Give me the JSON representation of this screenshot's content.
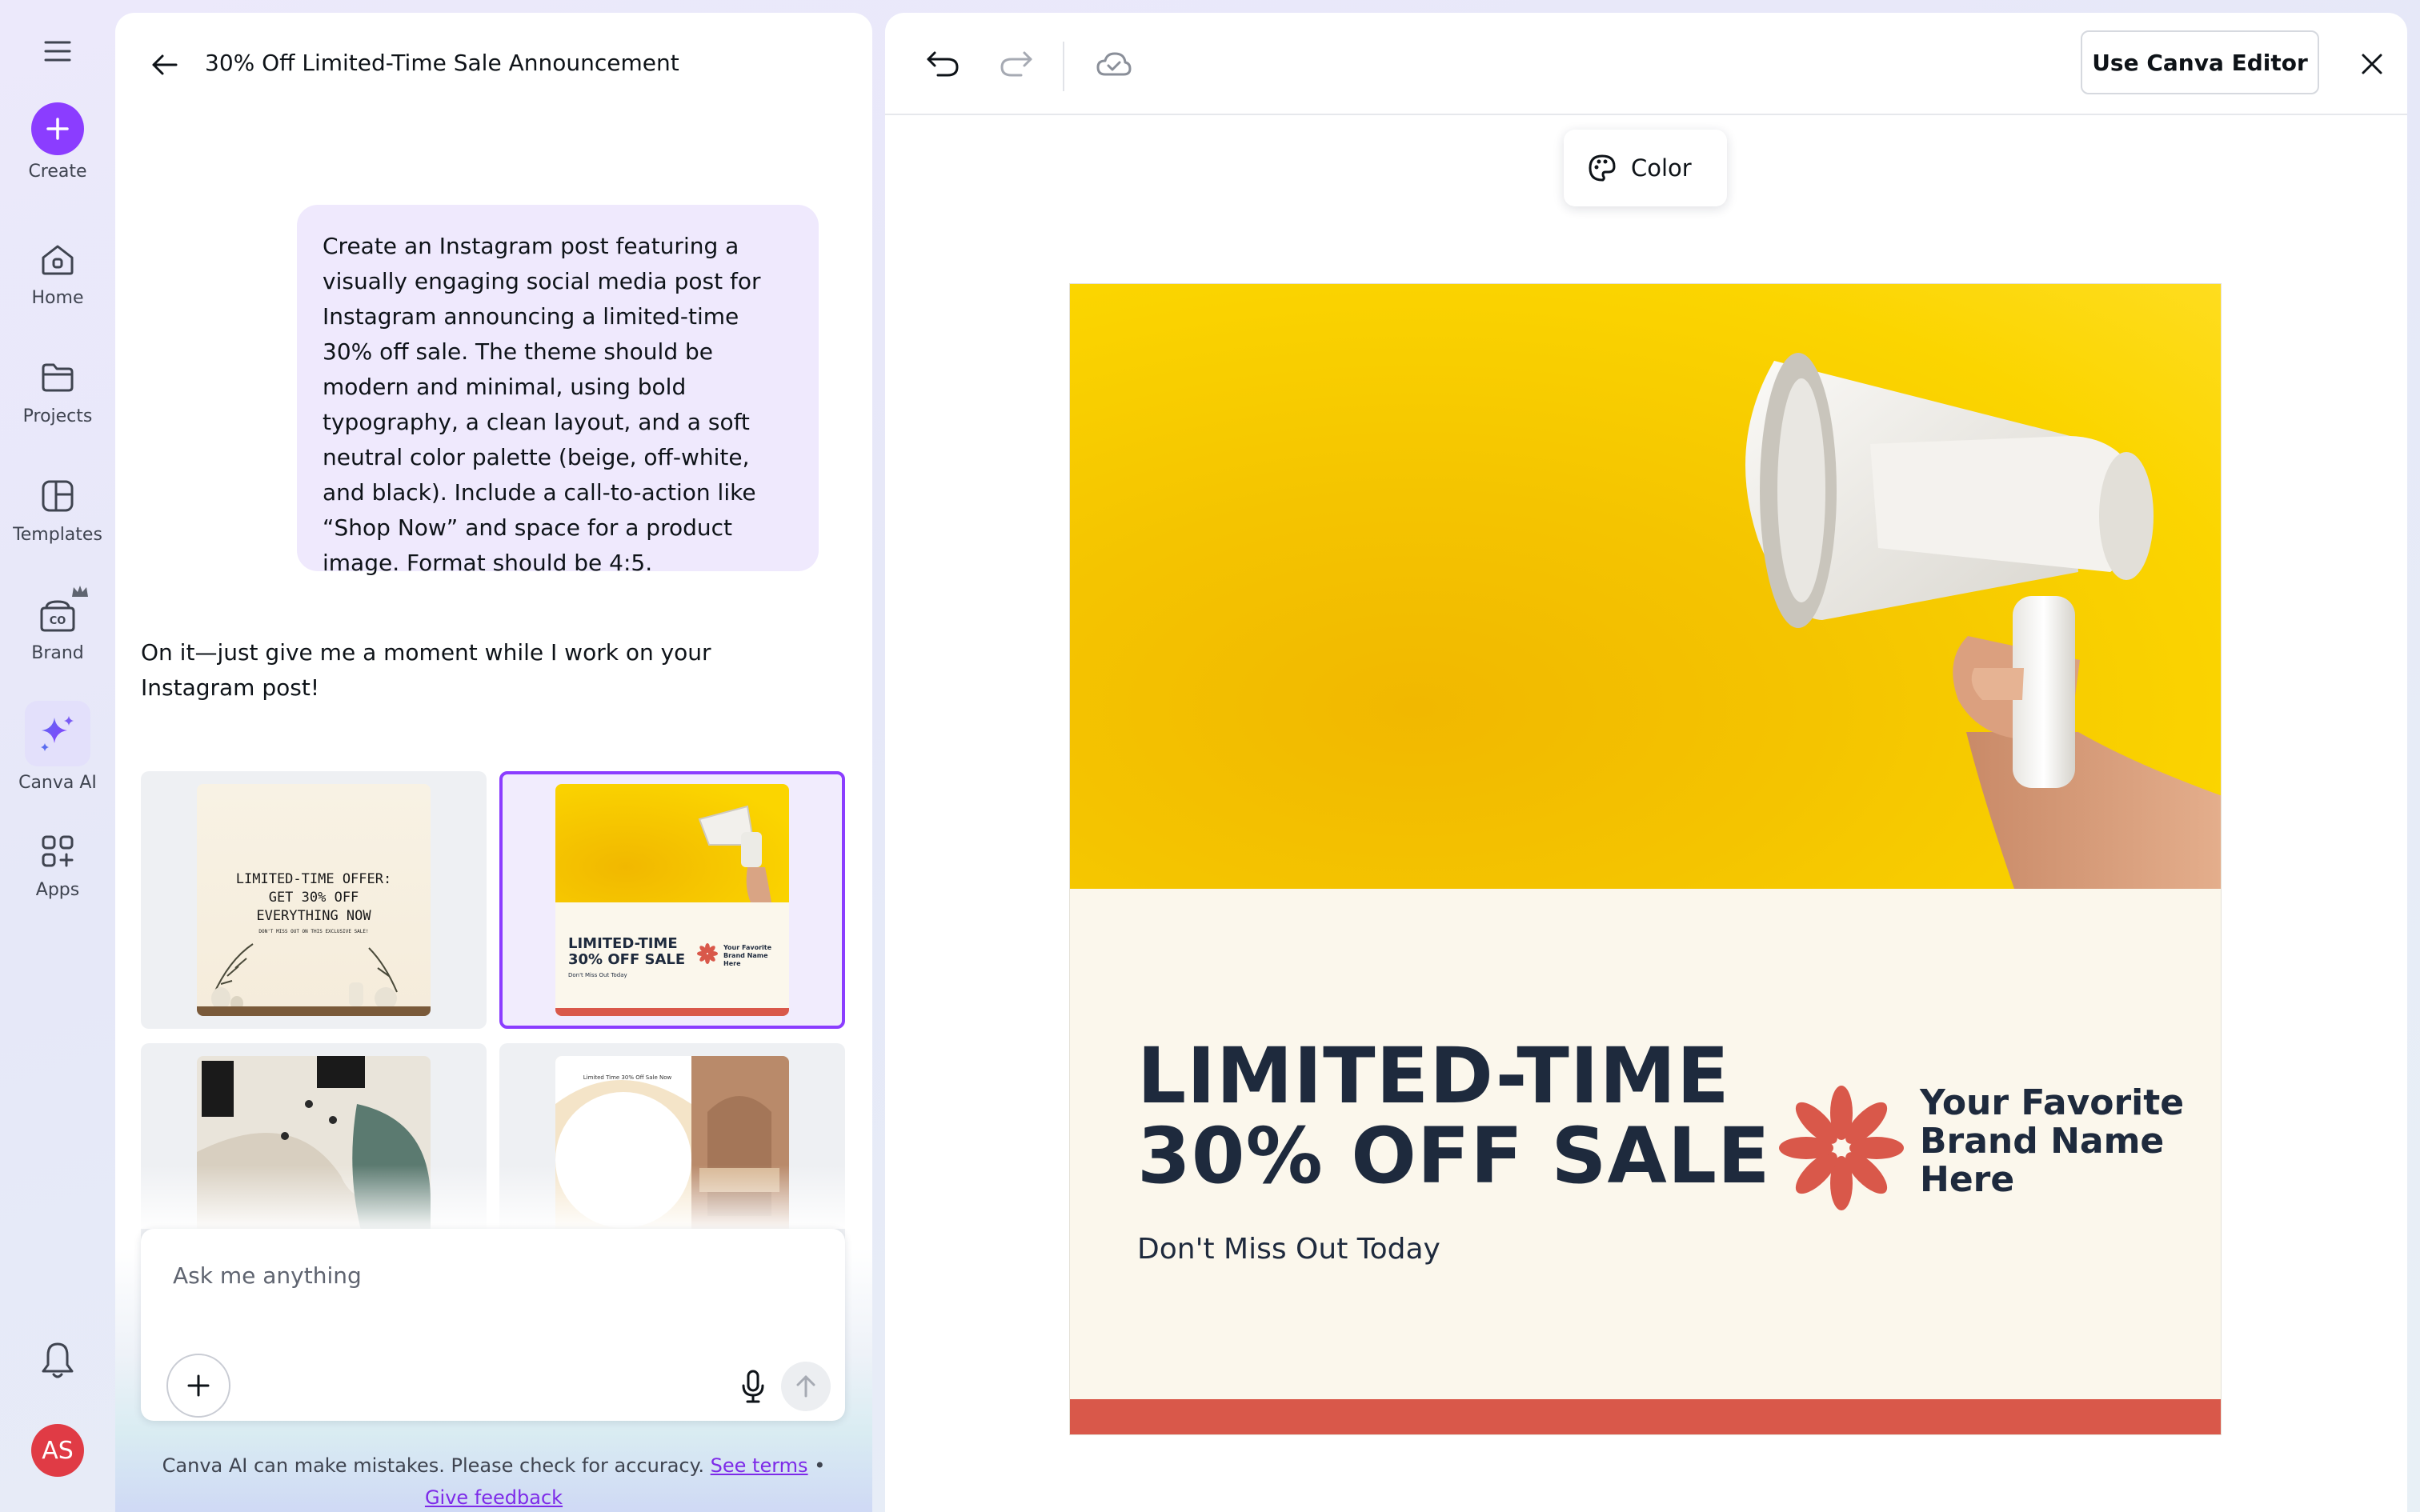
{
  "nav": {
    "create_label": "Create",
    "home_label": "Home",
    "projects_label": "Projects",
    "templates_label": "Templates",
    "brand_label": "Brand",
    "canva_ai_label": "Canva AI",
    "apps_label": "Apps",
    "avatar_initials": "AS"
  },
  "chat": {
    "title": "30% Off Limited-Time Sale Announcement",
    "user_prompt": "Create an Instagram post featuring a visually engaging social media post for Instagram announcing a limited-time 30% off sale. The theme should be modern and minimal, using bold typography, a clean layout, and a soft neutral color palette (beige, off-white, and black). Include a call-to-action like “Shop Now” and space for a product image. Format should be 4:5.",
    "ai_reply": "On it—just give me a moment while I work on your Instagram post!",
    "thumbnails": {
      "t1_line1": "LIMITED-TIME OFFER:",
      "t1_line2": "GET 30% OFF",
      "t1_line3": "EVERYTHING NOW",
      "t1_small": "DON'T MISS OUT ON THIS EXCLUSIVE SALE!",
      "t2_line1": "LIMITED-TIME",
      "t2_line2": "30% OFF SALE",
      "t2_small": "Don't Miss Out Today",
      "t2_brand": "Your Favorite Brand Name Here",
      "t4_small": "Limited Time 30% Off Sale Now"
    },
    "input_placeholder": "Ask me anything",
    "disclaimer_text": "Canva AI can make mistakes. Please check for accuracy.",
    "see_terms": "See terms",
    "separator": "•",
    "give_feedback": "Give feedback"
  },
  "editor": {
    "use_editor_label": "Use Canva Editor",
    "color_label": "Color",
    "design": {
      "headline_line1": "LIMITED-TIME",
      "headline_line2": "30% OFF SALE",
      "subtext": "Don't Miss Out Today",
      "brand_line1": "Your Favorite",
      "brand_line2": "Brand Name",
      "brand_line3": "Here"
    }
  },
  "colors": {
    "accent_purple": "#8b3dff",
    "design_yellow": "#f6c800",
    "design_cream": "#fbf7ec",
    "design_red": "#d9584a",
    "design_navy": "#1e2a3d"
  },
  "icons": [
    "menu-icon",
    "plus-icon",
    "home-icon",
    "folder-icon",
    "templates-icon",
    "brand-icon",
    "crown-icon",
    "sparkle-icon",
    "apps-icon",
    "bell-icon",
    "back-arrow-icon",
    "undo-icon",
    "redo-icon",
    "cloud-check-icon",
    "close-icon",
    "palette-icon",
    "microphone-icon",
    "send-arrow-icon",
    "megaphone-image",
    "flower-logo-icon"
  ]
}
